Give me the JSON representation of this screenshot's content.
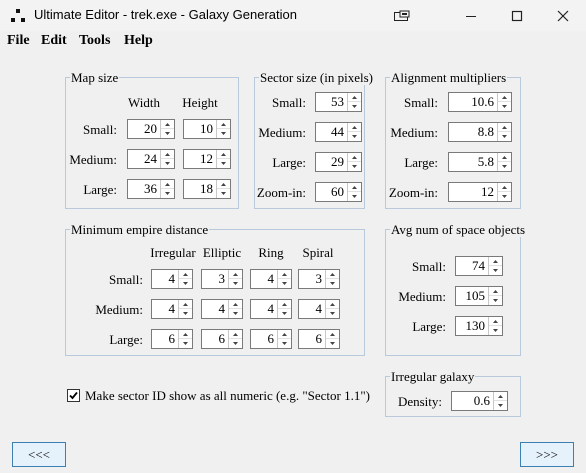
{
  "window": {
    "title": "Ultimate Editor - trek.exe - Galaxy Generation",
    "icons": {
      "app": "app-dots-icon",
      "extra": "tablet-icon",
      "minimize": "minimize-icon",
      "maximize": "maximize-icon",
      "close": "close-icon"
    }
  },
  "menu": [
    "File",
    "Edit",
    "Tools",
    "Help"
  ],
  "map_size": {
    "title": "Map size",
    "col_width": "Width",
    "col_height": "Height",
    "rows": [
      {
        "label": "Small:",
        "width": "20",
        "height": "10"
      },
      {
        "label": "Medium:",
        "width": "24",
        "height": "12"
      },
      {
        "label": "Large:",
        "width": "36",
        "height": "18"
      }
    ]
  },
  "sector_size": {
    "title": "Sector size (in pixels)",
    "rows": [
      {
        "label": "Small:",
        "value": "53"
      },
      {
        "label": "Medium:",
        "value": "44"
      },
      {
        "label": "Large:",
        "value": "29"
      },
      {
        "label": "Zoom-in:",
        "value": "60"
      }
    ]
  },
  "alignment": {
    "title": "Alignment multipliers",
    "rows": [
      {
        "label": "Small:",
        "value": "10.6"
      },
      {
        "label": "Medium:",
        "value": "8.8"
      },
      {
        "label": "Large:",
        "value": "5.8"
      },
      {
        "label": "Zoom-in:",
        "value": "12"
      }
    ]
  },
  "min_empire": {
    "title": "Minimum empire distance",
    "cols": [
      "Irregular",
      "Elliptic",
      "Ring",
      "Spiral"
    ],
    "rows": [
      {
        "label": "Small:",
        "values": [
          "4",
          "3",
          "4",
          "3"
        ]
      },
      {
        "label": "Medium:",
        "values": [
          "4",
          "4",
          "4",
          "4"
        ]
      },
      {
        "label": "Large:",
        "values": [
          "6",
          "6",
          "6",
          "6"
        ]
      }
    ]
  },
  "space_objects": {
    "title": "Avg num of space objects",
    "rows": [
      {
        "label": "Small:",
        "value": "74"
      },
      {
        "label": "Medium:",
        "value": "105"
      },
      {
        "label": "Large:",
        "value": "130"
      }
    ]
  },
  "irregular": {
    "title": "Irregular galaxy",
    "label": "Density:",
    "value": "0.6"
  },
  "numeric_id": {
    "label": "Make sector ID show as all numeric (e.g. \"Sector 1.1\")",
    "checked": true
  },
  "nav": {
    "prev": "<<<",
    "next": ">>>"
  }
}
